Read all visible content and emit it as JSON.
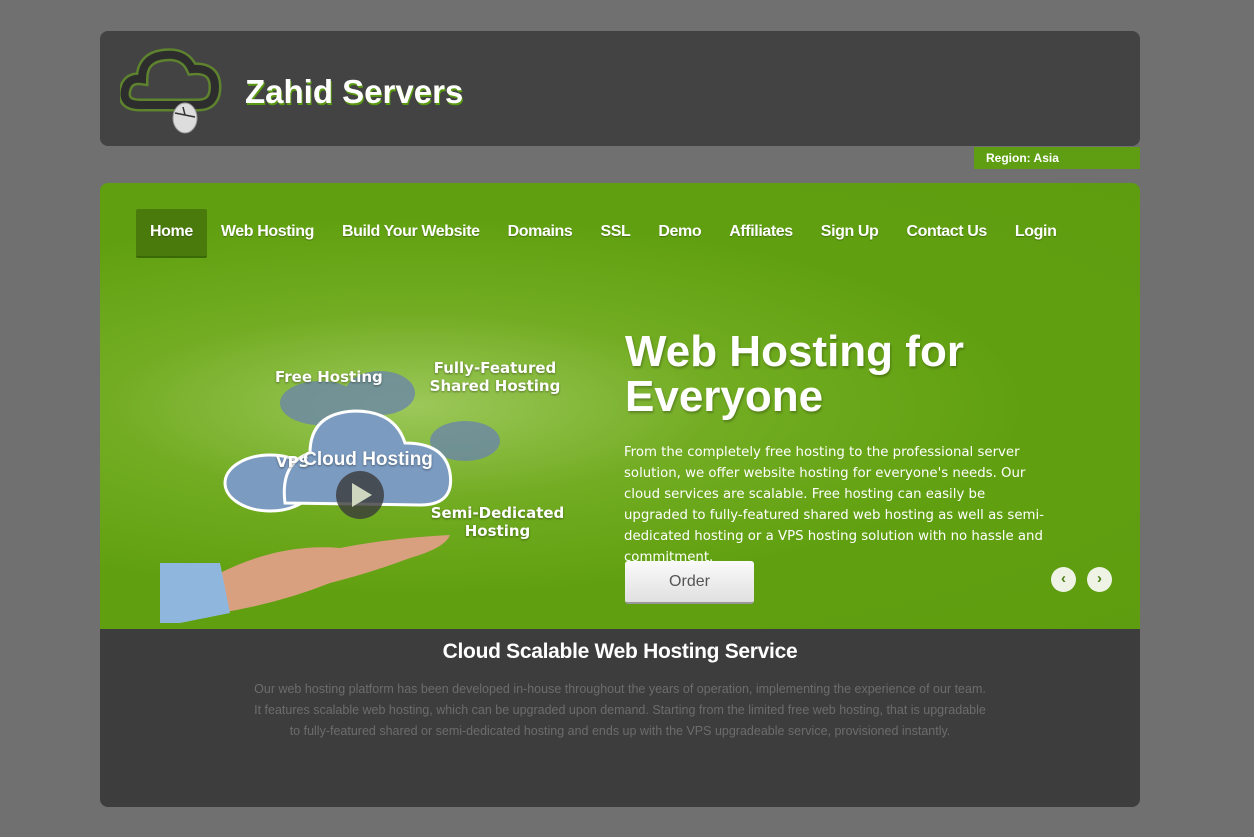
{
  "header": {
    "site_title": "Zahid Servers",
    "region": "Region: Asia"
  },
  "nav": {
    "items": [
      {
        "label": "Home",
        "active": true
      },
      {
        "label": "Web Hosting"
      },
      {
        "label": "Build Your Website"
      },
      {
        "label": "Domains"
      },
      {
        "label": "SSL"
      },
      {
        "label": "Demo"
      },
      {
        "label": "Affiliates"
      },
      {
        "label": "Sign Up"
      },
      {
        "label": "Contact Us"
      },
      {
        "label": "Login"
      }
    ]
  },
  "hero": {
    "image_labels": {
      "free": "Free Hosting",
      "shared": "Fully-Featured Shared Hosting",
      "vps": "VPS",
      "cloud": "Cloud Hosting",
      "semi": "Semi-Dedicated Hosting"
    },
    "title": "Web Hosting for Everyone",
    "text": "From the completely free hosting to the professional server solution, we offer website hosting for everyone's needs. Our cloud services are scalable. Free hosting can easily be upgraded to fully-featured shared web hosting as well as semi-dedicated hosting or a VPS hosting solution with no hassle and commitment.",
    "order_label": "Order",
    "prev_icon": "chevron-left-icon",
    "next_icon": "chevron-right-icon"
  },
  "section": {
    "title": "Cloud Scalable Web Hosting Service",
    "text": "Our web hosting platform has been developed in-house throughout the years of operation, implementing the experience of our team. It features scalable web hosting, which can be upgraded upon demand. Starting from the limited free web hosting, that is upgradable to fully-featured shared or semi-dedicated hosting and ends up with the VPS upgradeable service, provisioned instantly."
  },
  "colors": {
    "accent": "#5f9e12",
    "header_bg": "#434343",
    "bottom_bg": "#3d3d3d"
  }
}
